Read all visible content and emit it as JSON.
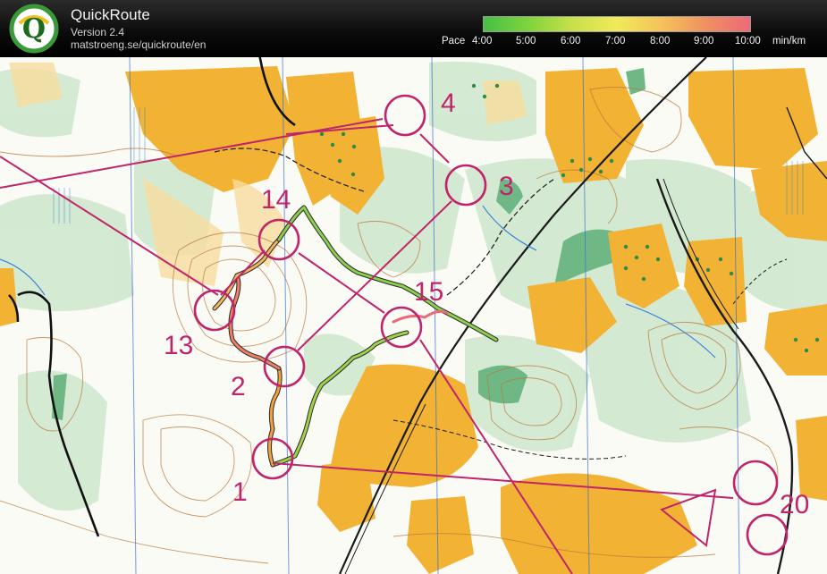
{
  "header": {
    "title": "QuickRoute",
    "version": "Version 2.4",
    "url": "matstroeng.se/quickroute/en",
    "logo_letter": "Q"
  },
  "pace_scale": {
    "label": "Pace",
    "ticks": [
      "4:00",
      "5:00",
      "6:00",
      "7:00",
      "8:00",
      "9:00",
      "10:00"
    ],
    "unit": "min/km",
    "colors": [
      "#46c046",
      "#7ed43c",
      "#c8e04a",
      "#f0ea5a",
      "#f6c25a",
      "#f09060",
      "#ec6a78"
    ]
  },
  "map": {
    "controls": [
      {
        "number": "1"
      },
      {
        "number": "2"
      },
      {
        "number": "3"
      },
      {
        "number": "4"
      },
      {
        "number": "13"
      },
      {
        "number": "14"
      },
      {
        "number": "15"
      },
      {
        "number": "20"
      }
    ],
    "course_color": "#c0246a"
  }
}
